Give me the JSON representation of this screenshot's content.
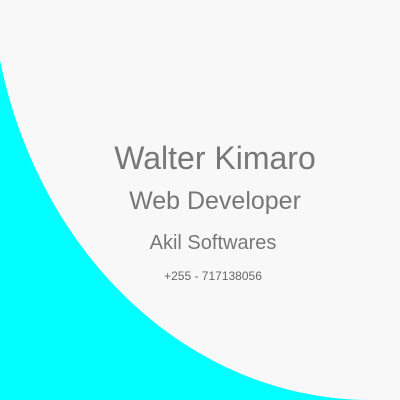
{
  "card": {
    "name": "Walter Kimaro",
    "title": "Web Developer",
    "company": "Akil Softwares",
    "phone": "+255 - 717138056"
  },
  "colors": {
    "accent": "#00ffff",
    "background": "#f8f8f8",
    "text": "#777777"
  }
}
